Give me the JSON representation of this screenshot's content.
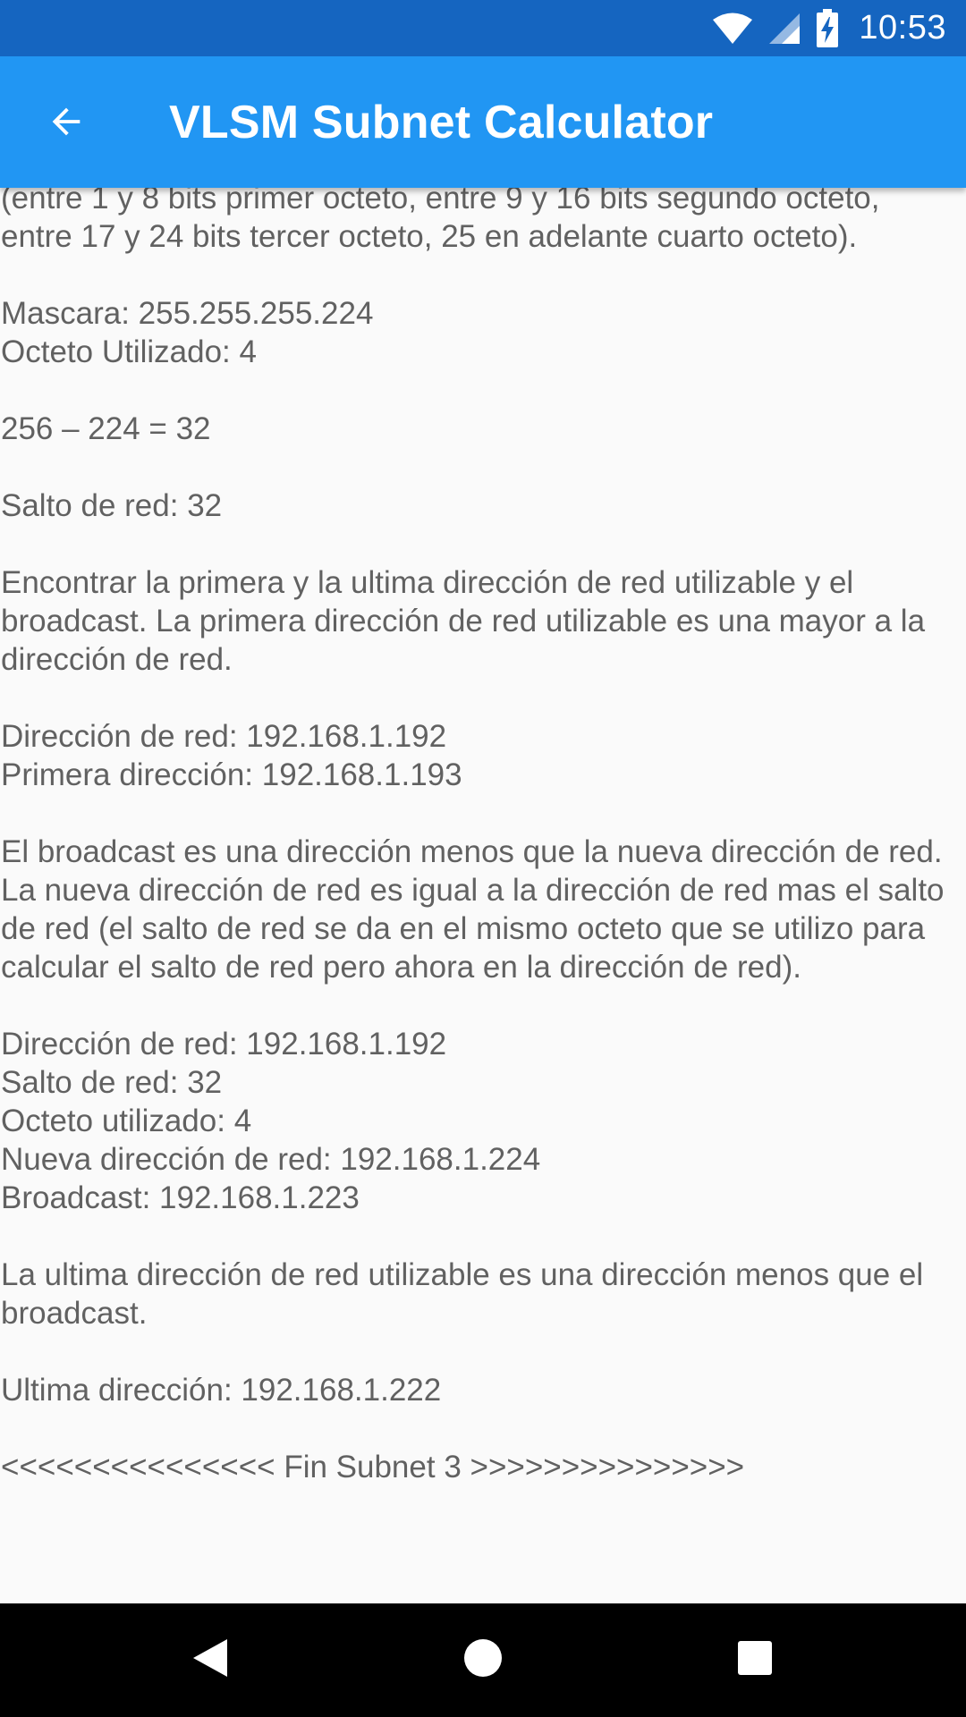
{
  "status_bar": {
    "time": "10:53",
    "icons": [
      "wifi-icon",
      "cell-signal-icon",
      "battery-charging-icon"
    ]
  },
  "app_bar": {
    "title": "VLSM Subnet Calculator",
    "back_icon": "arrow-back-icon"
  },
  "content": {
    "lines": [
      "(entre 1 y 8 bits primer octeto, entre 9 y 16 bits segundo octeto, entre 17 y 24 bits tercer octeto, 25 en adelante cuarto octeto).",
      "",
      "Mascara: 255.255.255.224",
      "Octeto Utilizado: 4",
      "",
      "256 – 224 = 32",
      "",
      "Salto de red: 32",
      "",
      "Encontrar la primera y la ultima dirección de red utilizable y el broadcast. La primera dirección de red utilizable es una mayor a la dirección de red.",
      "",
      "Dirección de red: 192.168.1.192",
      "Primera dirección: 192.168.1.193",
      "",
      "El broadcast es una dirección menos que la nueva dirección de red. La nueva dirección de red es igual a la dirección de red mas el salto de red (el salto de red se da en el mismo octeto que se utilizo para calcular el salto de red pero ahora en la dirección de red).",
      "",
      "Dirección de red: 192.168.1.192",
      "Salto de red: 32",
      "Octeto utilizado: 4",
      "Nueva dirección de red: 192.168.1.224",
      "Broadcast: 192.168.1.223",
      "",
      "La ultima dirección de red utilizable es una dirección menos que el broadcast.",
      "",
      "Ultima dirección: 192.168.1.222",
      "",
      "<<<<<<<<<<<<<<< Fin Subnet 3 >>>>>>>>>>>>>>>"
    ]
  },
  "nav_bar": {
    "buttons": [
      "back-triangle-icon",
      "home-circle-icon",
      "recents-square-icon"
    ]
  },
  "colors": {
    "status_bar": "#1565c0",
    "app_bar": "#2196f3",
    "background": "#fafafa",
    "text": "#616161",
    "nav_bar": "#000000"
  }
}
